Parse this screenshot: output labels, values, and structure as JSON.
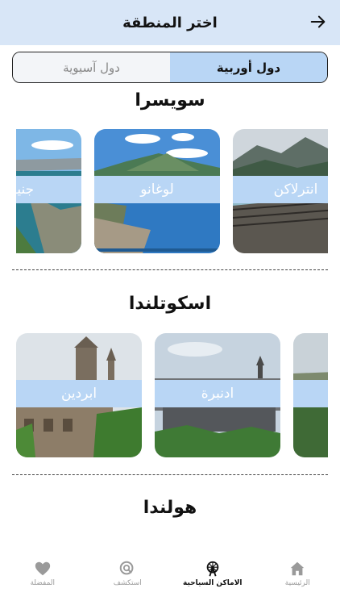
{
  "header": {
    "title": "اختر المنطقة",
    "back_icon": "arrow-right-icon"
  },
  "segment": {
    "europe_label": "دول أوربية",
    "asia_label": "دول آسيوية",
    "selected": "europe"
  },
  "sections": [
    {
      "title": "سويسرا",
      "cards": [
        {
          "label": "انترلاكن"
        },
        {
          "label": "لوغانو"
        },
        {
          "label": "جنيف"
        }
      ]
    },
    {
      "title": "اسكوتلندا",
      "cards": [
        {
          "label": "ادنبرة"
        },
        {
          "label": "ابردين"
        }
      ]
    },
    {
      "title": "هولندا"
    }
  ],
  "tabbar": {
    "items": [
      {
        "label": "الرئيسية",
        "icon": "home-icon"
      },
      {
        "label": "الاماكن السياحية",
        "icon": "ferris-wheel-icon"
      },
      {
        "label": "استكشف",
        "icon": "explore-search-icon"
      },
      {
        "label": "المفضلة",
        "icon": "heart-icon"
      }
    ],
    "active": "الاماكن السياحية"
  }
}
